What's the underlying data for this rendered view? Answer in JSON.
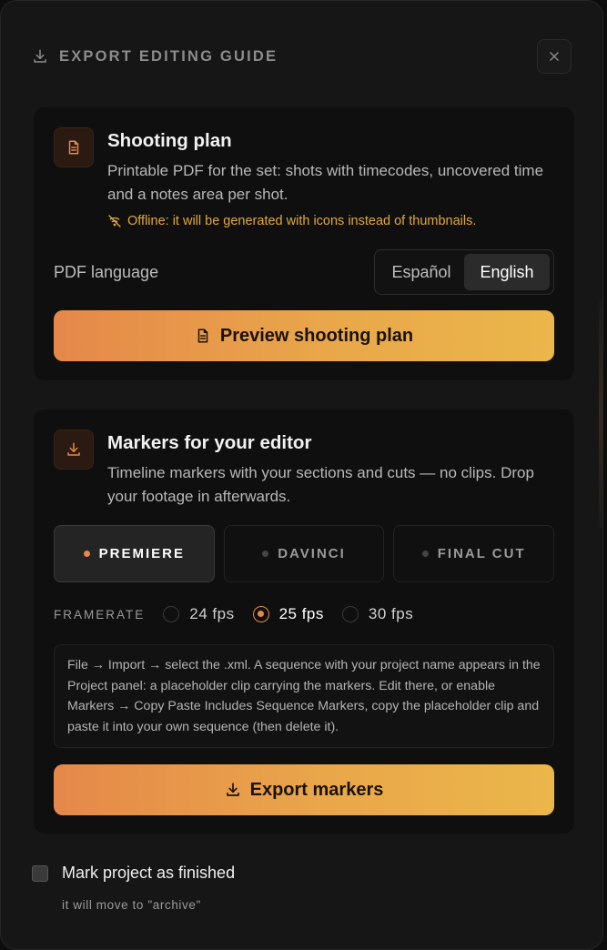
{
  "header": {
    "title": "EXPORT EDITING GUIDE",
    "close_icon": "close-icon",
    "download_icon": "download-icon"
  },
  "shooting_plan": {
    "icon": "document-icon",
    "title": "Shooting plan",
    "description": "Printable PDF for the set: shots with timecodes, uncovered time and a notes area per shot.",
    "offline_notice": "Offline: it will be generated with icons instead of thumbnails.",
    "language_label": "PDF language",
    "languages": [
      "Español",
      "English"
    ],
    "selected_language": "English",
    "preview_button": "Preview shooting plan"
  },
  "markers": {
    "icon": "download-icon",
    "title": "Markers for your editor",
    "description": "Timeline markers with your sections and cuts — no clips. Drop your footage in afterwards.",
    "tools": [
      "PREMIERE",
      "DAVINCI",
      "FINAL CUT"
    ],
    "selected_tool": "PREMIERE",
    "framerate_label": "FRAMERATE",
    "framerates": [
      "24 fps",
      "25 fps",
      "30 fps"
    ],
    "selected_framerate": "25 fps",
    "instructions": "File → Import → select the .xml. A sequence with your project name appears in the Project panel: a placeholder clip carrying the markers. Edit there, or enable Markers → Copy Paste Includes Sequence Markers, copy the placeholder clip and paste it into your own sequence (then delete it).",
    "export_button": "Export markers"
  },
  "finish": {
    "label": "Mark project as finished",
    "hint": "it will move to \"archive\"",
    "checked": false
  },
  "colors": {
    "accent": "#e8874a",
    "accent_end": "#ebb64a",
    "warning": "#e2a93b",
    "background": "#161616"
  }
}
